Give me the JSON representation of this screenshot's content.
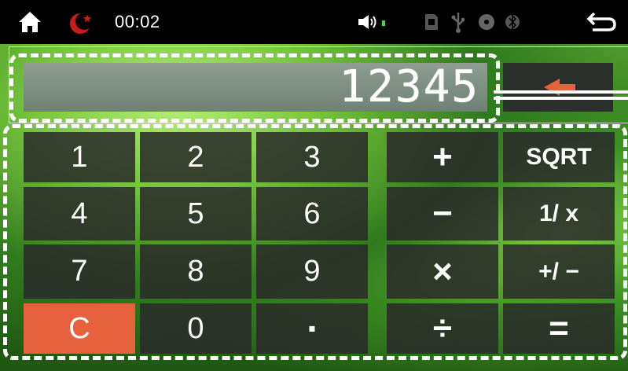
{
  "status_bar": {
    "time": "00:02",
    "icons": [
      "home-icon",
      "crescent-star-icon",
      "volume-icon",
      "sd-card-icon",
      "usb-icon",
      "disc-icon",
      "bluetooth-icon",
      "back-arrow-icon"
    ],
    "accent_color": "#cc1a1a"
  },
  "display": {
    "value": "12345"
  },
  "keypad": {
    "rows": [
      [
        {
          "label": "1"
        },
        {
          "label": "2"
        },
        {
          "label": "3"
        },
        {
          "label": "+"
        },
        {
          "label": "SQRT"
        }
      ],
      [
        {
          "label": "4"
        },
        {
          "label": "5"
        },
        {
          "label": "6"
        },
        {
          "label": "−"
        },
        {
          "label": "1/ x"
        }
      ],
      [
        {
          "label": "7"
        },
        {
          "label": "8"
        },
        {
          "label": "9"
        },
        {
          "label": "×"
        },
        {
          "label": "+/ −"
        }
      ],
      [
        {
          "label": "C"
        },
        {
          "label": "0"
        },
        {
          "label": "▪"
        },
        {
          "label": "÷"
        },
        {
          "label": "="
        }
      ]
    ],
    "clear_color": "#e8613d"
  }
}
